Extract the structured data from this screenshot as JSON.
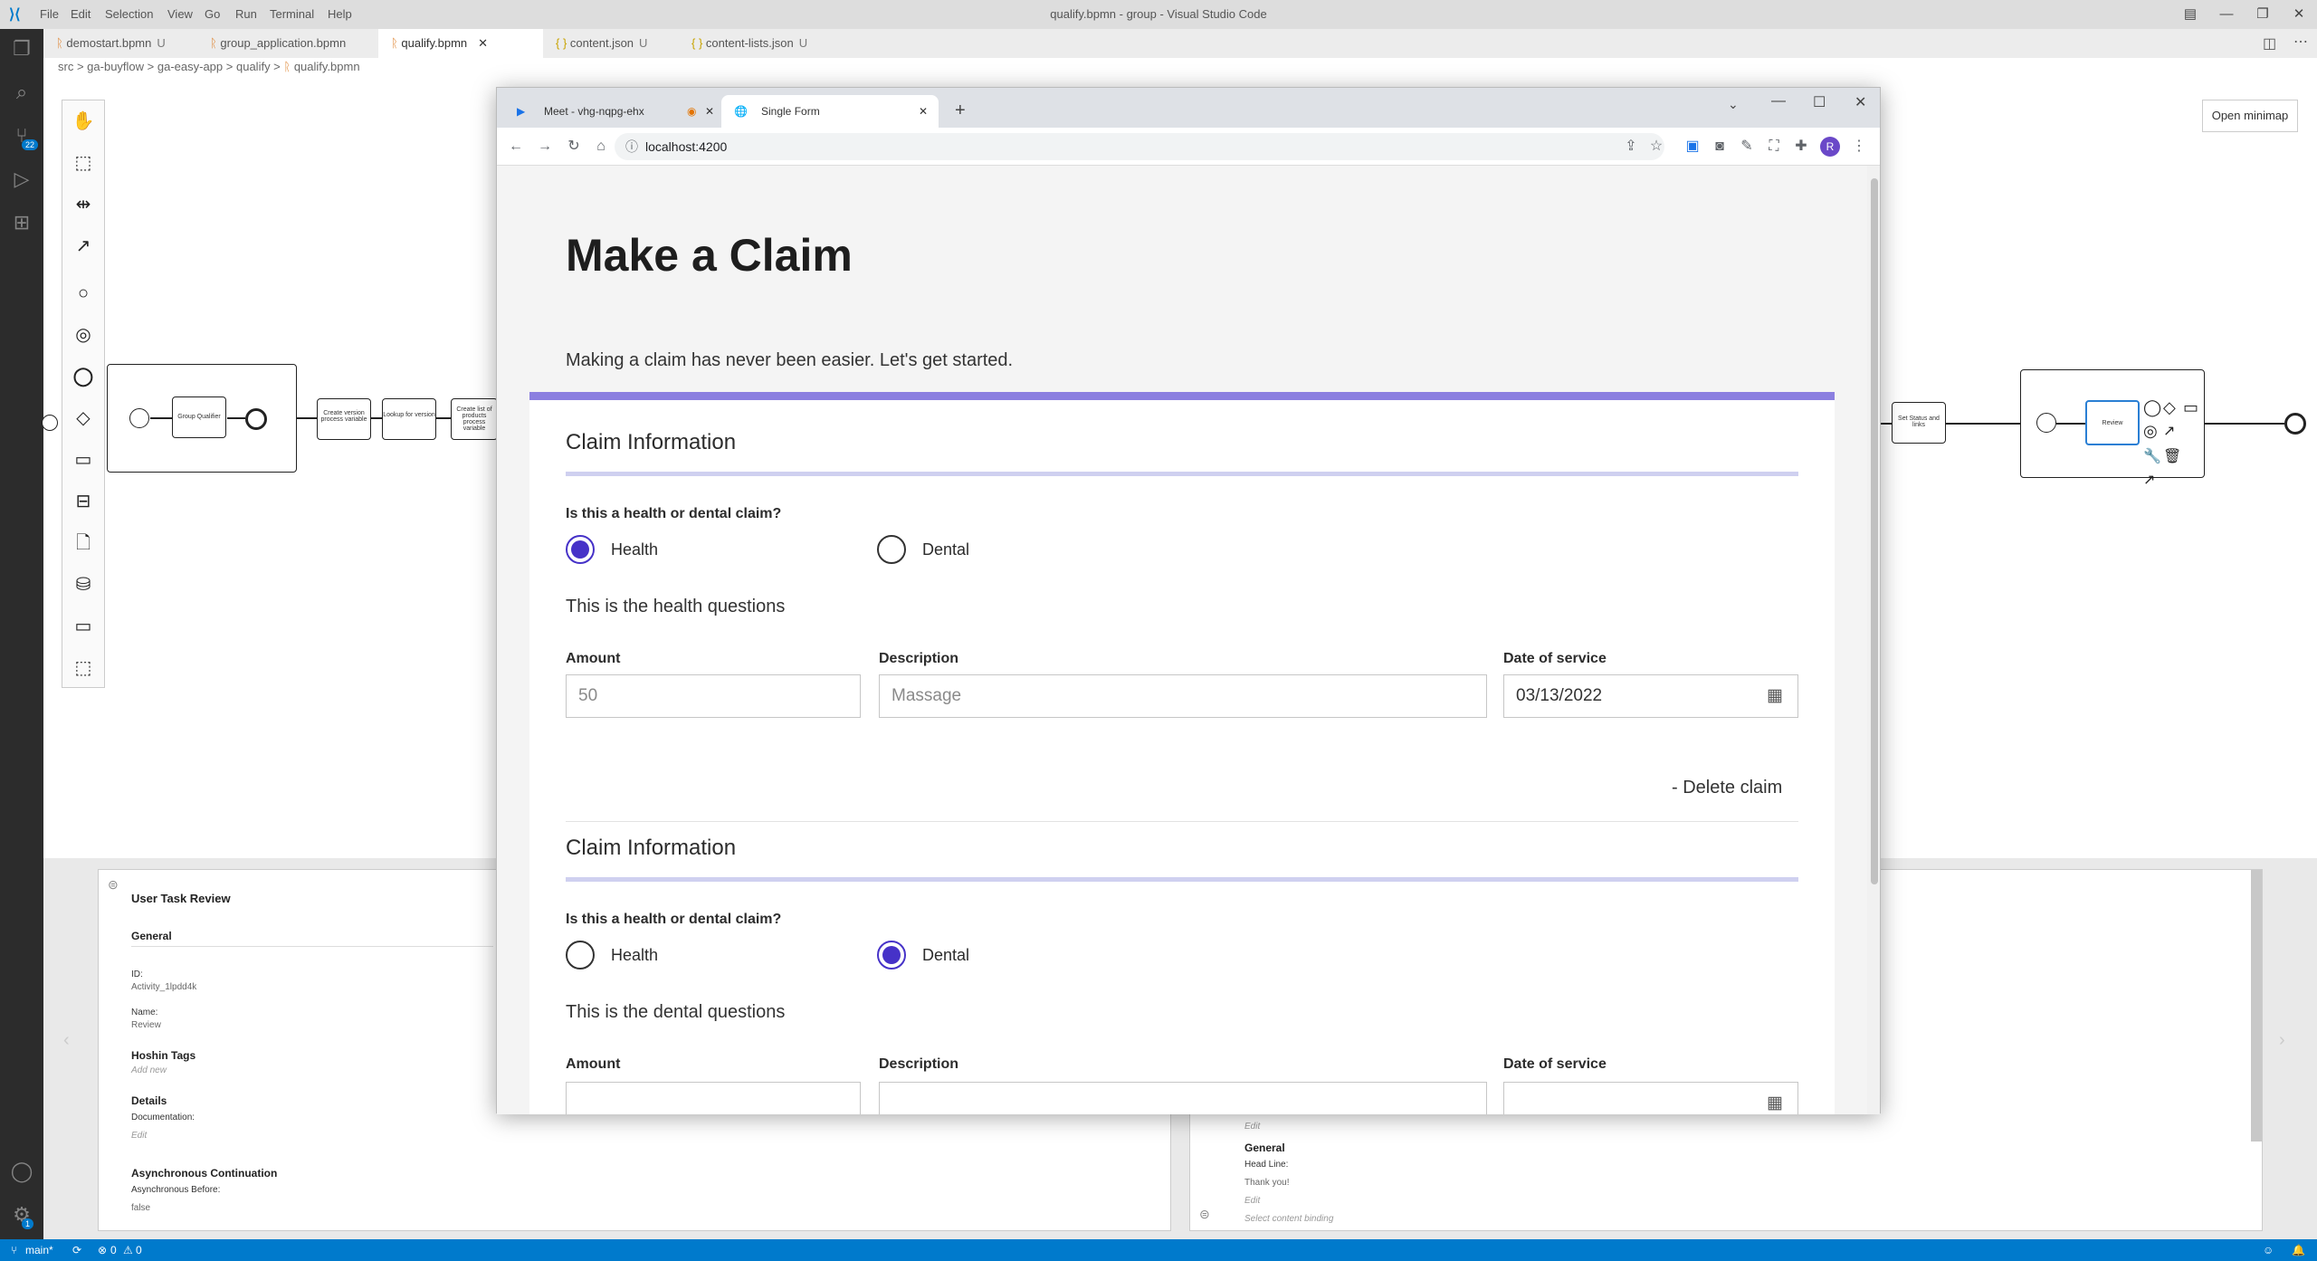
{
  "vscode": {
    "menu": [
      "File",
      "Edit",
      "Selection",
      "View",
      "Go",
      "Run",
      "Terminal",
      "Help"
    ],
    "window_title": "qualify.bpmn - group - Visual Studio Code",
    "tabs": [
      {
        "label": "demostart.bpmn",
        "status": "U"
      },
      {
        "label": "group_application.bpmn",
        "status": ""
      },
      {
        "label": "qualify.bpmn",
        "status": ""
      },
      {
        "label": "content.json",
        "status": "U"
      },
      {
        "label": "content-lists.json",
        "status": "U"
      }
    ],
    "breadcrumb": [
      "src",
      "ga-buyflow",
      "ga-easy-app",
      "qualify",
      "qualify.bpmn"
    ],
    "open_minimap": "Open minimap",
    "scm_badge": "22",
    "gear_badge": "1",
    "diagram": {
      "task_group_qualifier": "Group Qualifier",
      "task_create_version": "Create version process variable",
      "task_lookup": "Lookup for version",
      "task_create_list": "Create list of products process variable",
      "task_set_status": "Set Status and links",
      "task_review": "Review"
    },
    "properties_left": {
      "title": "User Task Review",
      "general": "General",
      "id_label": "ID:",
      "id_value": "Activity_1lpdd4k",
      "name_label": "Name:",
      "name_value": "Review",
      "hoshin_tags": "Hoshin Tags",
      "add_new": "Add new",
      "details": "Details",
      "documentation": "Documentation:",
      "edit": "Edit",
      "async": "Asynchronous Continuation",
      "async_before": "Asynchronous Before:",
      "async_before_value": "false"
    },
    "properties_right": {
      "edit_top": "Edit",
      "general": "General",
      "headline_label": "Head Line:",
      "headline_value": "Thank you!",
      "edit": "Edit",
      "binding": "Select content binding"
    },
    "status": {
      "branch": "main*",
      "problems": "0",
      "warnings": "0"
    }
  },
  "browser": {
    "tabs": [
      {
        "label": "Meet - vhg-nqpg-ehx"
      },
      {
        "label": "Single Form"
      }
    ],
    "url": "localhost:4200",
    "profile_initial": "R"
  },
  "form": {
    "title": "Make a Claim",
    "subtitle": "Making a claim has never been easier. Let's get started.",
    "accent": "#8b7fe0",
    "radio_accent": "#4632c8",
    "claims": [
      {
        "heading": "Claim Information",
        "question": "Is this a health or dental claim?",
        "option_health": "Health",
        "option_dental": "Dental",
        "selected": "Health",
        "note": "This is the health questions",
        "amount_label": "Amount",
        "amount_value": "50",
        "description_label": "Description",
        "description_value": "Massage",
        "date_label": "Date of service",
        "date_value": "03/13/2022",
        "delete": "- Delete claim"
      },
      {
        "heading": "Claim Information",
        "question": "Is this a health or dental claim?",
        "option_health": "Health",
        "option_dental": "Dental",
        "selected": "Dental",
        "note": "This is the dental questions",
        "amount_label": "Amount",
        "description_label": "Description",
        "date_label": "Date of service"
      }
    ]
  }
}
